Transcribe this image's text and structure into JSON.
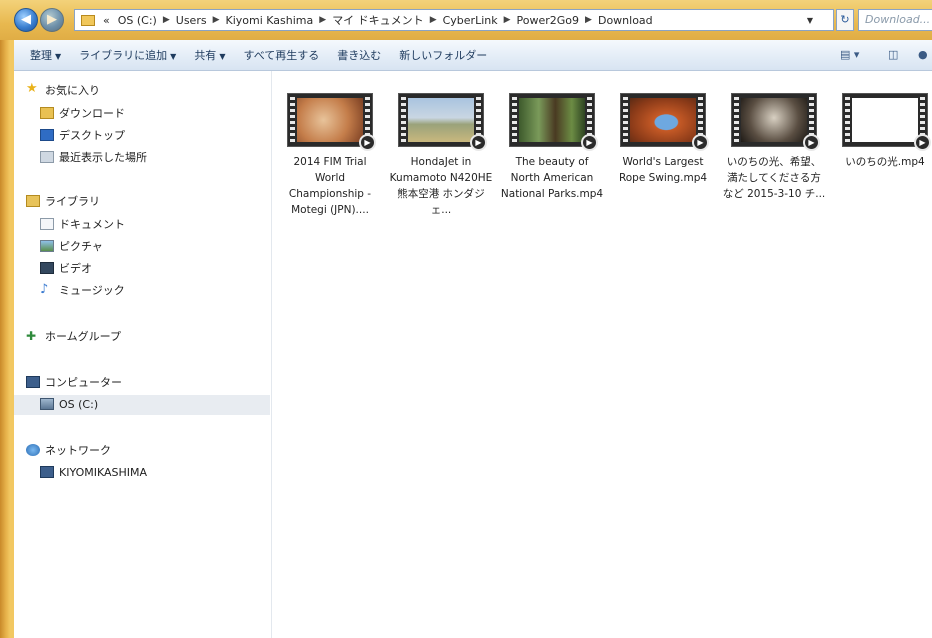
{
  "address": {
    "crumbs": [
      "«",
      "OS (C:)",
      "Users",
      "Kiyomi Kashima",
      "マイ ドキュメント",
      "CyberLink",
      "Power2Go9",
      "Download"
    ],
    "search_placeholder": "Download..."
  },
  "toolbar": {
    "organize": "整理",
    "add_to_library": "ライブラリに追加",
    "share": "共有",
    "play_all": "すべて再生する",
    "burn": "書き込む",
    "new_folder": "新しいフォルダー"
  },
  "sidebar": {
    "favorites": "お気に入り",
    "downloads": "ダウンロード",
    "desktop": "デスクトップ",
    "recent": "最近表示した場所",
    "libraries": "ライブラリ",
    "documents": "ドキュメント",
    "pictures": "ピクチャ",
    "videos": "ビデオ",
    "music": "ミュージック",
    "homegroup": "ホームグループ",
    "computer": "コンピューター",
    "os_c": "OS (C:)",
    "network": "ネットワーク",
    "pc_name": "KIYOMIKASHIMA"
  },
  "files": [
    {
      "name": "2014 FIM Trial World Championship - Motegi (JPN)...."
    },
    {
      "name": "HondaJet in Kumamoto N420HE 熊本空港 ホンダジェ..."
    },
    {
      "name": "The beauty of North American National Parks.mp4"
    },
    {
      "name": "World's Largest Rope Swing.mp4"
    },
    {
      "name": "いのちの光、希望、満たしてくださる方など 2015-3-10 チ..."
    },
    {
      "name": "いのちの光.mp4"
    }
  ]
}
